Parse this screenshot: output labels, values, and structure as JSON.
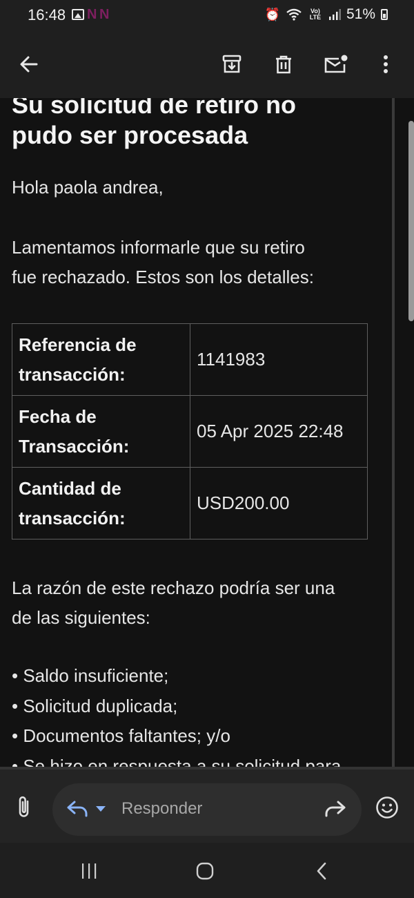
{
  "status_bar": {
    "time": "16:48",
    "app_notification": "N N",
    "battery": "51%",
    "lte_label": "Vo) LTE"
  },
  "toolbar": {
    "back_icon": "arrow-left-icon",
    "archive_icon": "archive-icon",
    "delete_icon": "trash-icon",
    "mark_unread_icon": "mail-unread-icon",
    "more_icon": "more-vert-icon"
  },
  "email": {
    "subject_line1": "Su solicitud de retiro no",
    "subject_line2": "pudo ser procesada",
    "greeting": "Hola paola andrea,",
    "intro_line1": "Lamentamos informarle que su retiro",
    "intro_line2": "fue rechazado. Estos son los detalles:",
    "details": [
      {
        "label_line1": "Referencia de",
        "label_line2": "transacción:",
        "value": "1141983"
      },
      {
        "label_line1": "Fecha de",
        "label_line2": "Transacción:",
        "value": "05 Apr 2025 22:48"
      },
      {
        "label_line1": "Cantidad de",
        "label_line2": "transacción:",
        "value": "USD200.00"
      }
    ],
    "reason_line1": "La razón de este rechazo podría ser una",
    "reason_line2": "de las siguientes:",
    "reasons": [
      "Saldo insuficiente;",
      "Solicitud duplicada;",
      "Documentos faltantes; y/o",
      "Se hizo en respuesta a su solicitud para"
    ]
  },
  "reply_bar": {
    "placeholder": "Responder"
  },
  "colors": {
    "background": "#121212",
    "bar": "#1f1f1f",
    "text": "#e6e6e6",
    "accent": "#8ab4f8"
  }
}
